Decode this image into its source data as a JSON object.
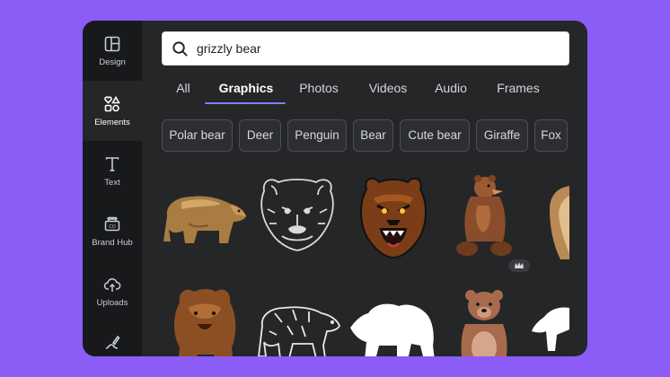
{
  "sidebar": {
    "items": [
      {
        "label": "Design",
        "icon": "layout-icon"
      },
      {
        "label": "Elements",
        "icon": "shapes-icon"
      },
      {
        "label": "Text",
        "icon": "text-t-icon"
      },
      {
        "label": "Brand Hub",
        "icon": "brand-hub-icon"
      },
      {
        "label": "Uploads",
        "icon": "cloud-upload-icon"
      },
      {
        "label": "",
        "icon": "draw-icon"
      }
    ],
    "active": "Elements"
  },
  "search": {
    "value": "grizzly bear",
    "icon": "search-icon"
  },
  "tabs": [
    {
      "label": "All"
    },
    {
      "label": "Graphics"
    },
    {
      "label": "Photos"
    },
    {
      "label": "Videos"
    },
    {
      "label": "Audio"
    },
    {
      "label": "Frames"
    }
  ],
  "active_tab": "Graphics",
  "chips": [
    "Polar bear",
    "Deer",
    "Penguin",
    "Bear",
    "Cute bear",
    "Giraffe",
    "Fox"
  ],
  "results": [
    {
      "name": "brown bear walking illustration",
      "premium": false
    },
    {
      "name": "grizzly face line sketch",
      "premium": false
    },
    {
      "name": "roaring grizzly head",
      "premium": false
    },
    {
      "name": "sitting brown bear",
      "premium": true
    },
    {
      "name": "bear cut off",
      "premium": false
    },
    {
      "name": "grizzly bear charging",
      "premium": true
    },
    {
      "name": "bear outline walking",
      "premium": true
    },
    {
      "name": "white bear silhouette",
      "premium": true
    },
    {
      "name": "standing cartoon bear",
      "premium": false
    },
    {
      "name": "bear silhouette cut off",
      "premium": false
    }
  ],
  "colors": {
    "accent": "#8b7cf0",
    "background": "#8b5cf6",
    "panel": "#252627",
    "sidebar": "#18191b"
  }
}
